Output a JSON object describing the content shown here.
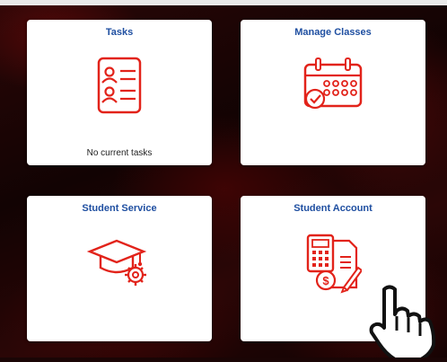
{
  "theme": {
    "accent": "#e2231a",
    "title_color": "#1f4fa1"
  },
  "tiles": [
    {
      "title": "Tasks",
      "icon": "task-list-icon",
      "footer": "No current tasks"
    },
    {
      "title": "Manage Classes",
      "icon": "calendar-check-icon",
      "footer": ""
    },
    {
      "title": "Student Service",
      "icon": "graduation-cap-gear-icon",
      "footer": ""
    },
    {
      "title": "Student Account",
      "icon": "calculator-invoice-icon",
      "footer": ""
    }
  ],
  "cursor": {
    "icon": "hand-pointer-icon"
  }
}
